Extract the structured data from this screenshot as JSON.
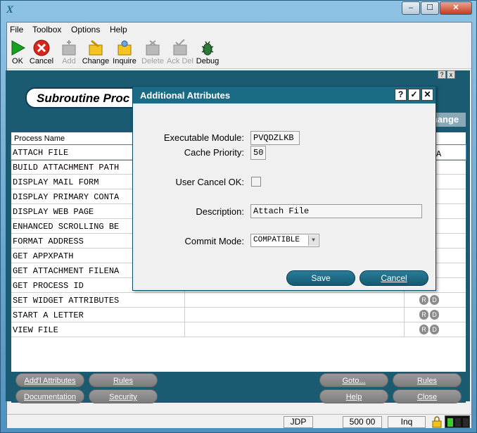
{
  "window": {
    "close_label": "✕",
    "max_label": "☐",
    "min_label": "–",
    "app_icon": "X"
  },
  "menu": [
    "File",
    "Toolbox",
    "Options",
    "Help"
  ],
  "toolbar": [
    {
      "label": "OK",
      "icon": "ok-icon",
      "enabled": true
    },
    {
      "label": "Cancel",
      "icon": "cancel-icon",
      "enabled": true
    },
    {
      "label": "Add",
      "icon": "add-icon",
      "enabled": false
    },
    {
      "label": "Change",
      "icon": "change-icon",
      "enabled": true
    },
    {
      "label": "Inquire",
      "icon": "inquire-icon",
      "enabled": true
    },
    {
      "label": "Delete",
      "icon": "delete-icon",
      "enabled": false
    },
    {
      "label": "Ack Del",
      "icon": "ack-del-icon",
      "enabled": false
    },
    {
      "label": "Debug",
      "icon": "debug-icon",
      "enabled": true
    }
  ],
  "panel": {
    "title": "Subroutine Proc",
    "exchange_label": "hange",
    "column_header": "Process Name",
    "selected_suffix": "A",
    "mini_buttons": [
      "?",
      "x"
    ]
  },
  "rows": [
    {
      "name": "ATTACH FILE",
      "selected": true
    },
    {
      "name": "BUILD ATTACHMENT PATH"
    },
    {
      "name": "DISPLAY MAIL FORM"
    },
    {
      "name": "DISPLAY PRIMARY CONTA"
    },
    {
      "name": "DISPLAY WEB PAGE"
    },
    {
      "name": "ENHANCED SCROLLING BE"
    },
    {
      "name": "FORMAT ADDRESS"
    },
    {
      "name": "GET APPXPATH"
    },
    {
      "name": "GET ATTACHMENT FILENA"
    },
    {
      "name": "GET PROCESS ID"
    },
    {
      "name": "SET WIDGET ATTRIBUTES"
    },
    {
      "name": "START A LETTER"
    },
    {
      "name": "VIEW FILE"
    }
  ],
  "row_buttons": {
    "r": "R",
    "d": "D"
  },
  "bottom_buttons": {
    "addl": "Add'l Attributes",
    "rules_left": "Rules",
    "documentation": "Documentation",
    "security": "Security",
    "goto": "Goto...",
    "rules_right": "Rules",
    "help": "Help",
    "close": "Close"
  },
  "status": {
    "jdp": "JDP",
    "time": "500 00",
    "mode": "Inq"
  },
  "dialog": {
    "title": "Additional Attributes",
    "buttons": [
      "?",
      "✓",
      "✕"
    ],
    "exec_label": "Executable Module:",
    "exec_value": "PVQDZLKB",
    "cache_label": "Cache Priority:",
    "cache_value": "50",
    "usercancel_label": "User Cancel OK:",
    "description_label": "Description:",
    "description_value": "Attach File",
    "commit_label": "Commit Mode:",
    "commit_value": "COMPATIBLE",
    "save": "Save",
    "cancel": "Cancel"
  }
}
